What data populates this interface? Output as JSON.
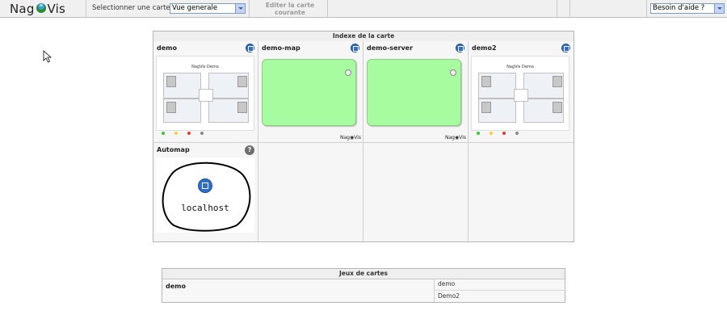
{
  "header": {
    "logo_left": "Nag",
    "logo_right": "Vis",
    "select_label": "Selectionner une carte:",
    "map_select_value": "Vue generale",
    "edit_map_line1": "Editer la carte",
    "edit_map_line2": "courante",
    "help_select_value": "Besoin d'aide ?"
  },
  "index": {
    "title": "Indexe de la carte",
    "maps": [
      {
        "name": "demo",
        "thumb_title": "NagVis Demo"
      },
      {
        "name": "demo-map",
        "thumb_label": "Nag◉Vis"
      },
      {
        "name": "demo-server",
        "thumb_label": "Nag◉Vis"
      },
      {
        "name": "demo2",
        "thumb_title": "NagVis Demo"
      },
      {
        "name": "Automap",
        "host": "localhost"
      }
    ]
  },
  "rotations": {
    "title": "Jeux de cartes",
    "name": "demo",
    "items": [
      "demo",
      "Demo2"
    ]
  },
  "colors": {
    "green_map": "#a8fca0",
    "icon_blue": "#2f6fc5"
  }
}
